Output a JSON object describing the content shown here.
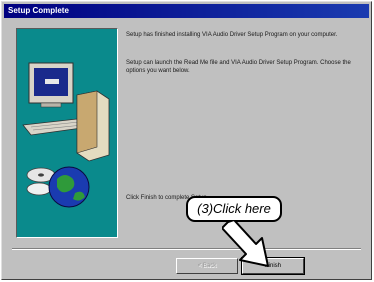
{
  "window": {
    "title": "Setup Complete"
  },
  "messages": {
    "line1": "Setup has finished installing VIA Audio Driver Setup Program on your computer.",
    "line2": "Setup can launch the Read Me file and VIA Audio Driver Setup Program. Choose the options you want below.",
    "finish_hint": "Click Finish to complete Setup."
  },
  "buttons": {
    "back": "< Back",
    "finish": "Finish"
  },
  "annotation": {
    "text": "(3)Click here"
  },
  "colors": {
    "titlebar": "#000080",
    "panel": "#0a8a8c",
    "dialog": "#c0c0c0"
  },
  "icons": {
    "art": "computer-with-globe-icon",
    "pointer": "arrow-icon"
  }
}
